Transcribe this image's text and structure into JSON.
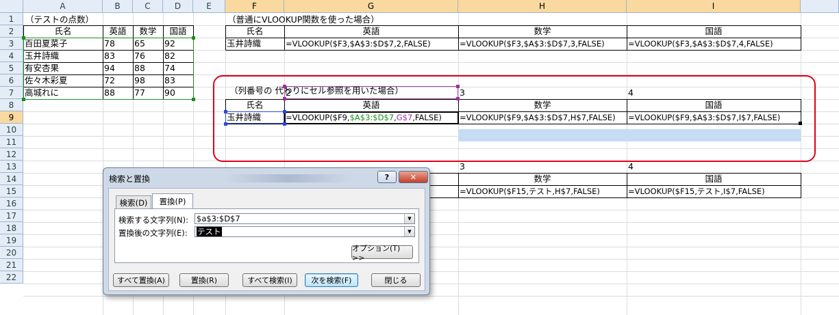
{
  "columns": [
    {
      "label": "A",
      "selected": false
    },
    {
      "label": "B",
      "selected": false
    },
    {
      "label": "C",
      "selected": false
    },
    {
      "label": "D",
      "selected": false
    },
    {
      "label": "E",
      "selected": false
    },
    {
      "label": "F",
      "selected": true
    },
    {
      "label": "G",
      "selected": true
    },
    {
      "label": "H",
      "selected": true
    },
    {
      "label": "I",
      "selected": true
    }
  ],
  "rows": [
    "1",
    "2",
    "3",
    "4",
    "5",
    "6",
    "7",
    "8",
    "9",
    "10",
    "11",
    "12",
    "13",
    "14",
    "15",
    "16",
    "17",
    "18",
    "19",
    "20",
    "21",
    "22"
  ],
  "selected_row": "9",
  "table1": {
    "title": "（テストの点数）",
    "headers": [
      "氏名",
      "英語",
      "数学",
      "国語"
    ],
    "rows": [
      [
        "百田夏菜子",
        "78",
        "65",
        "92"
      ],
      [
        "玉井詩織",
        "83",
        "76",
        "82"
      ],
      [
        "有安杏果",
        "94",
        "88",
        "74"
      ],
      [
        "佐々木彩夏",
        "72",
        "98",
        "83"
      ],
      [
        "高城れに",
        "88",
        "77",
        "90"
      ]
    ]
  },
  "table2": {
    "title": "（普通にVLOOKUP関数を使った場合）",
    "headers": [
      "氏名",
      "英語",
      "数学",
      "国語"
    ],
    "name": "玉井詩織",
    "formulas": [
      "=VLOOKUP($F3,$A$3:$D$7,2,FALSE)",
      "=VLOOKUP($F3,$A$3:$D$7,3,FALSE)",
      "=VLOOKUP($F3,$A$3:$D$7,4,FALSE)"
    ]
  },
  "table3": {
    "title": "（列番号の 代わりにセル参照を用いた場合）",
    "colnums": [
      "2",
      "3",
      "4"
    ],
    "headers": [
      "氏名",
      "英語",
      "数学",
      "国語"
    ],
    "name": "玉井詩織",
    "g9_parts": [
      "=VLOOKUP($F9,",
      "$A$3:$D$7",
      ",",
      "G$7",
      ",FALSE)"
    ],
    "formulas": [
      "=VLOOKUP($F9,$A$3:$D$7,H$7,FALSE)",
      "=VLOOKUP($F9,$A$3:$D$7,I$7,FALSE)"
    ]
  },
  "table4": {
    "colnums": [
      "3",
      "4"
    ],
    "headers": [
      "数学",
      "国語"
    ],
    "formulas": [
      "=VLOOKUP($F15,テスト,H$7,FALSE)",
      "=VLOOKUP($F15,テスト,I$7,FALSE)"
    ]
  },
  "colors": {
    "highlight_border": "#e0001a",
    "green_ref": "#1a8f1a",
    "purple_ref": "#a32ca3",
    "selection": "#c6dcf3"
  },
  "dialog": {
    "title": "検索と置換",
    "help": "?",
    "close": "✕",
    "tab_find": "検索(D)",
    "tab_replace": "置換(P)",
    "find_label": "検索する文字列(N):",
    "find_value": "$a$3:$D$7",
    "replace_label": "置換後の文字列(E):",
    "replace_value": "テスト",
    "options_button": "オプション(T) >>",
    "buttons": {
      "replace_all": "すべて置換(A)",
      "replace": "置換(R)",
      "find_all": "すべて検索(I)",
      "find_next": "次を検索(F)",
      "close": "閉じる"
    }
  }
}
